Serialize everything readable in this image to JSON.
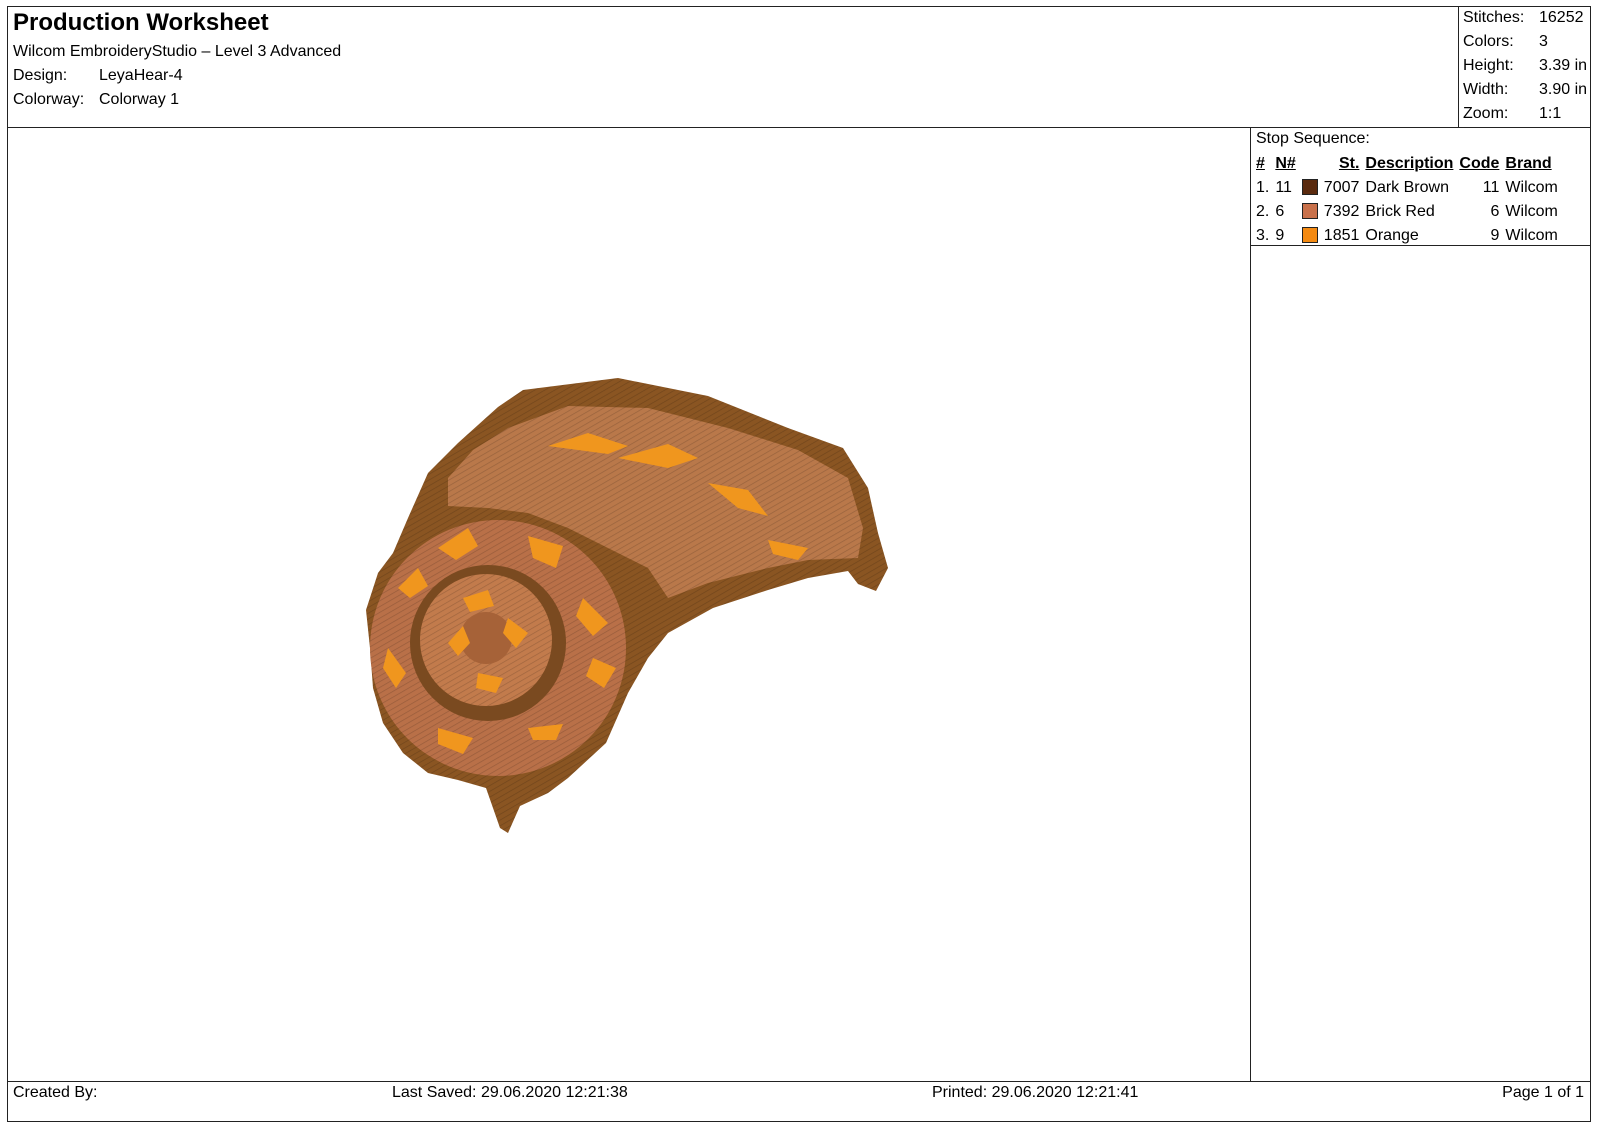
{
  "header": {
    "title": "Production Worksheet",
    "software": "Wilcom EmbroideryStudio – Level 3 Advanced",
    "design_label": "Design:",
    "design_value": "LeyaHear-4",
    "colorway_label": "Colorway:",
    "colorway_value": "Colorway 1"
  },
  "stats": [
    {
      "label": "Stitches:",
      "value": "16252"
    },
    {
      "label": "Colors:",
      "value": "3"
    },
    {
      "label": "Height:",
      "value": "3.39 in"
    },
    {
      "label": "Width:",
      "value": "3.90 in"
    },
    {
      "label": "Zoom:",
      "value": "1:1"
    }
  ],
  "stop_sequence": {
    "title": "Stop Sequence:",
    "columns": [
      "#",
      "N#",
      "St.",
      "Description",
      "Code",
      "Brand"
    ],
    "rows": [
      {
        "num": "1.",
        "n": "11",
        "color": "#5a2a0e",
        "st": "7007",
        "description": "Dark Brown",
        "code": "11",
        "brand": "Wilcom"
      },
      {
        "num": "2.",
        "n": "6",
        "color": "#c8704a",
        "st": "7392",
        "description": "Brick Red",
        "code": "6",
        "brand": "Wilcom"
      },
      {
        "num": "3.",
        "n": "9",
        "color": "#f48a12",
        "st": "1851",
        "description": "Orange",
        "code": "9",
        "brand": "Wilcom"
      }
    ]
  },
  "footer": {
    "created_by": "Created By:",
    "last_saved": "Last Saved: 29.06.2020 12:21:38",
    "printed": "Printed: 29.06.2020 12:21:41",
    "page": "Page 1 of 1"
  }
}
